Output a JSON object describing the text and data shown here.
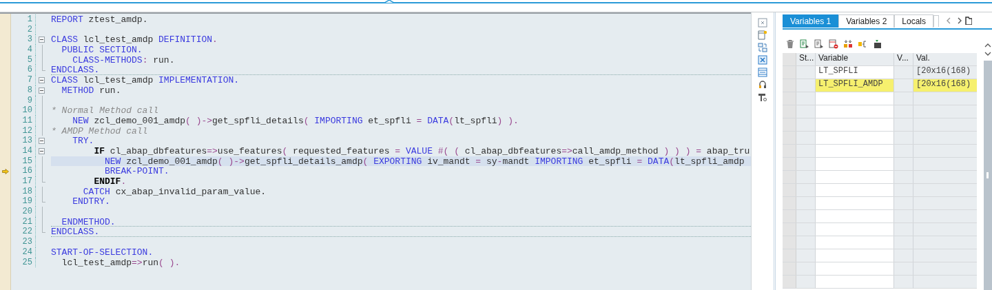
{
  "editor": {
    "lines": [
      {
        "number": "1",
        "tokens": [
          {
            "kind": "keyword",
            "text": "REPORT"
          },
          {
            "kind": "plain",
            "text": " ztest_amdp."
          }
        ]
      },
      {
        "number": "2"
      },
      {
        "number": "3",
        "fold": {
          "kind": "toggle",
          "expanded": true
        },
        "tokens": [
          {
            "kind": "keyword",
            "text": "CLASS"
          },
          {
            "kind": "plain",
            "text": " lcl_test_amdp "
          },
          {
            "kind": "keyword",
            "text": "DEFINITION"
          },
          {
            "kind": "punct",
            "text": "."
          }
        ]
      },
      {
        "number": "4",
        "fold": {
          "kind": "line"
        },
        "tokens": [
          {
            "kind": "keyword",
            "text": "  PUBLIC SECTION."
          }
        ]
      },
      {
        "number": "5",
        "fold": {
          "kind": "line"
        },
        "tokens": [
          {
            "kind": "keyword",
            "text": "    CLASS-METHODS"
          },
          {
            "kind": "punct",
            "text": ":"
          },
          {
            "kind": "plain",
            "text": " run."
          }
        ]
      },
      {
        "number": "6",
        "fold": {
          "kind": "end"
        },
        "separator_below": true,
        "tokens": [
          {
            "kind": "keyword",
            "text": "ENDCLASS."
          }
        ]
      },
      {
        "number": "7",
        "fold": {
          "kind": "toggle",
          "expanded": true
        },
        "tokens": [
          {
            "kind": "keyword",
            "text": "CLASS"
          },
          {
            "kind": "plain",
            "text": " lcl_test_amdp "
          },
          {
            "kind": "keyword",
            "text": "IMPLEMENTATION."
          }
        ]
      },
      {
        "number": "8",
        "fold": {
          "kind": "toggle",
          "expanded": true
        },
        "tokens": [
          {
            "kind": "keyword",
            "text": "  METHOD"
          },
          {
            "kind": "plain",
            "text": " run."
          }
        ]
      },
      {
        "number": "9",
        "fold": {
          "kind": "line"
        }
      },
      {
        "number": "10",
        "fold": {
          "kind": "line"
        },
        "tokens": [
          {
            "kind": "comment",
            "text": "* Normal Method call"
          }
        ]
      },
      {
        "number": "11",
        "fold": {
          "kind": "line"
        },
        "tokens": [
          {
            "kind": "keyword",
            "text": "    NEW"
          },
          {
            "kind": "plain",
            "text": " zcl_demo_001_amdp"
          },
          {
            "kind": "punct",
            "text": "( )->"
          },
          {
            "kind": "plain",
            "text": "get_spfli_details"
          },
          {
            "kind": "punct",
            "text": "( "
          },
          {
            "kind": "keyword",
            "text": "IMPORTING"
          },
          {
            "kind": "plain",
            "text": " et_spfli "
          },
          {
            "kind": "punct",
            "text": "= "
          },
          {
            "kind": "keyword",
            "text": "DATA"
          },
          {
            "kind": "punct",
            "text": "("
          },
          {
            "kind": "plain",
            "text": "lt_spfli"
          },
          {
            "kind": "punct",
            "text": ") )."
          }
        ]
      },
      {
        "number": "12",
        "fold": {
          "kind": "line"
        },
        "tokens": [
          {
            "kind": "comment",
            "text": "* AMDP Method call"
          }
        ]
      },
      {
        "number": "13",
        "fold": {
          "kind": "toggle",
          "expanded": true
        },
        "tokens": [
          {
            "kind": "keyword",
            "text": "    TRY."
          }
        ]
      },
      {
        "number": "14",
        "fold": {
          "kind": "toggle",
          "expanded": true
        },
        "tokens": [
          {
            "kind": "strong",
            "text": "        IF"
          },
          {
            "kind": "plain",
            "text": " cl_abap_dbfeatures"
          },
          {
            "kind": "punct",
            "text": "=>"
          },
          {
            "kind": "plain",
            "text": "use_features"
          },
          {
            "kind": "punct",
            "text": "( "
          },
          {
            "kind": "plain",
            "text": "requested_features "
          },
          {
            "kind": "punct",
            "text": "= "
          },
          {
            "kind": "keyword",
            "text": "VALUE"
          },
          {
            "kind": "punct",
            "text": " #( ( "
          },
          {
            "kind": "plain",
            "text": "cl_abap_dbfeatures"
          },
          {
            "kind": "punct",
            "text": "=>"
          },
          {
            "kind": "plain",
            "text": "call_amdp_method "
          },
          {
            "kind": "punct",
            "text": ") ) ) = "
          },
          {
            "kind": "plain",
            "text": "abap_tru"
          }
        ]
      },
      {
        "number": "15",
        "fold": {
          "kind": "line"
        },
        "highlighted": true,
        "tokens": [
          {
            "kind": "keyword",
            "text": "          NEW"
          },
          {
            "kind": "plain",
            "text": " zcl_demo_001_amdp"
          },
          {
            "kind": "punct",
            "text": "( )->"
          },
          {
            "kind": "plain",
            "text": "get_spfli_details_amdp"
          },
          {
            "kind": "punct",
            "text": "( "
          },
          {
            "kind": "keyword",
            "text": "EXPORTING"
          },
          {
            "kind": "plain",
            "text": " iv_mandt "
          },
          {
            "kind": "punct",
            "text": "="
          },
          {
            "kind": "plain",
            "text": " sy"
          },
          {
            "kind": "punct",
            "text": "-"
          },
          {
            "kind": "plain",
            "text": "mandt "
          },
          {
            "kind": "keyword",
            "text": "IMPORTING"
          },
          {
            "kind": "plain",
            "text": " et_spfli "
          },
          {
            "kind": "punct",
            "text": "= "
          },
          {
            "kind": "keyword",
            "text": "DATA"
          },
          {
            "kind": "punct",
            "text": "("
          },
          {
            "kind": "plain",
            "text": "lt_spfli_amdp"
          }
        ]
      },
      {
        "number": "16",
        "fold": {
          "kind": "line"
        },
        "current": true,
        "tokens": [
          {
            "kind": "keyword",
            "text": "          BREAK-POINT."
          }
        ]
      },
      {
        "number": "17",
        "fold": {
          "kind": "end"
        },
        "tokens": [
          {
            "kind": "strong",
            "text": "        ENDIF"
          },
          {
            "kind": "punct",
            "text": "."
          }
        ]
      },
      {
        "number": "18",
        "fold": {
          "kind": "line"
        },
        "tokens": [
          {
            "kind": "keyword",
            "text": "      CATCH"
          },
          {
            "kind": "plain",
            "text": " cx_abap_invalid_param_value."
          }
        ]
      },
      {
        "number": "19",
        "fold": {
          "kind": "end"
        },
        "tokens": [
          {
            "kind": "keyword",
            "text": "    ENDTRY."
          }
        ]
      },
      {
        "number": "20",
        "fold": {
          "kind": "line"
        }
      },
      {
        "number": "21",
        "fold": {
          "kind": "line"
        },
        "separator_below": true,
        "tokens": [
          {
            "kind": "keyword",
            "text": "  ENDMETHOD."
          }
        ]
      },
      {
        "number": "22",
        "fold": {
          "kind": "end"
        },
        "separator_below": true,
        "tokens": [
          {
            "kind": "keyword",
            "text": "ENDCLASS."
          }
        ]
      },
      {
        "number": "23"
      },
      {
        "number": "24",
        "tokens": [
          {
            "kind": "keyword",
            "text": "START-OF-SELECTION."
          }
        ]
      },
      {
        "number": "25",
        "tokens": [
          {
            "kind": "plain",
            "text": "  lcl_test_amdp"
          },
          {
            "kind": "punct",
            "text": "=>"
          },
          {
            "kind": "plain",
            "text": "run"
          },
          {
            "kind": "punct",
            "text": "( )."
          }
        ]
      }
    ]
  },
  "variables_panel": {
    "tabs": [
      {
        "label": "Variables 1",
        "selected": true
      },
      {
        "label": "Variables 2",
        "selected": false
      },
      {
        "label": "Locals",
        "selected": false
      }
    ],
    "table": {
      "columns": [
        "St...",
        "Variable",
        "V...",
        "Val."
      ],
      "rows": [
        {
          "variable": "LT_SPFLI",
          "value": "[20x16(168)",
          "highlighted": false
        },
        {
          "variable": "LT_SPFLI_AMDP",
          "value": "[20x16(168)",
          "highlighted": true
        }
      ]
    }
  }
}
